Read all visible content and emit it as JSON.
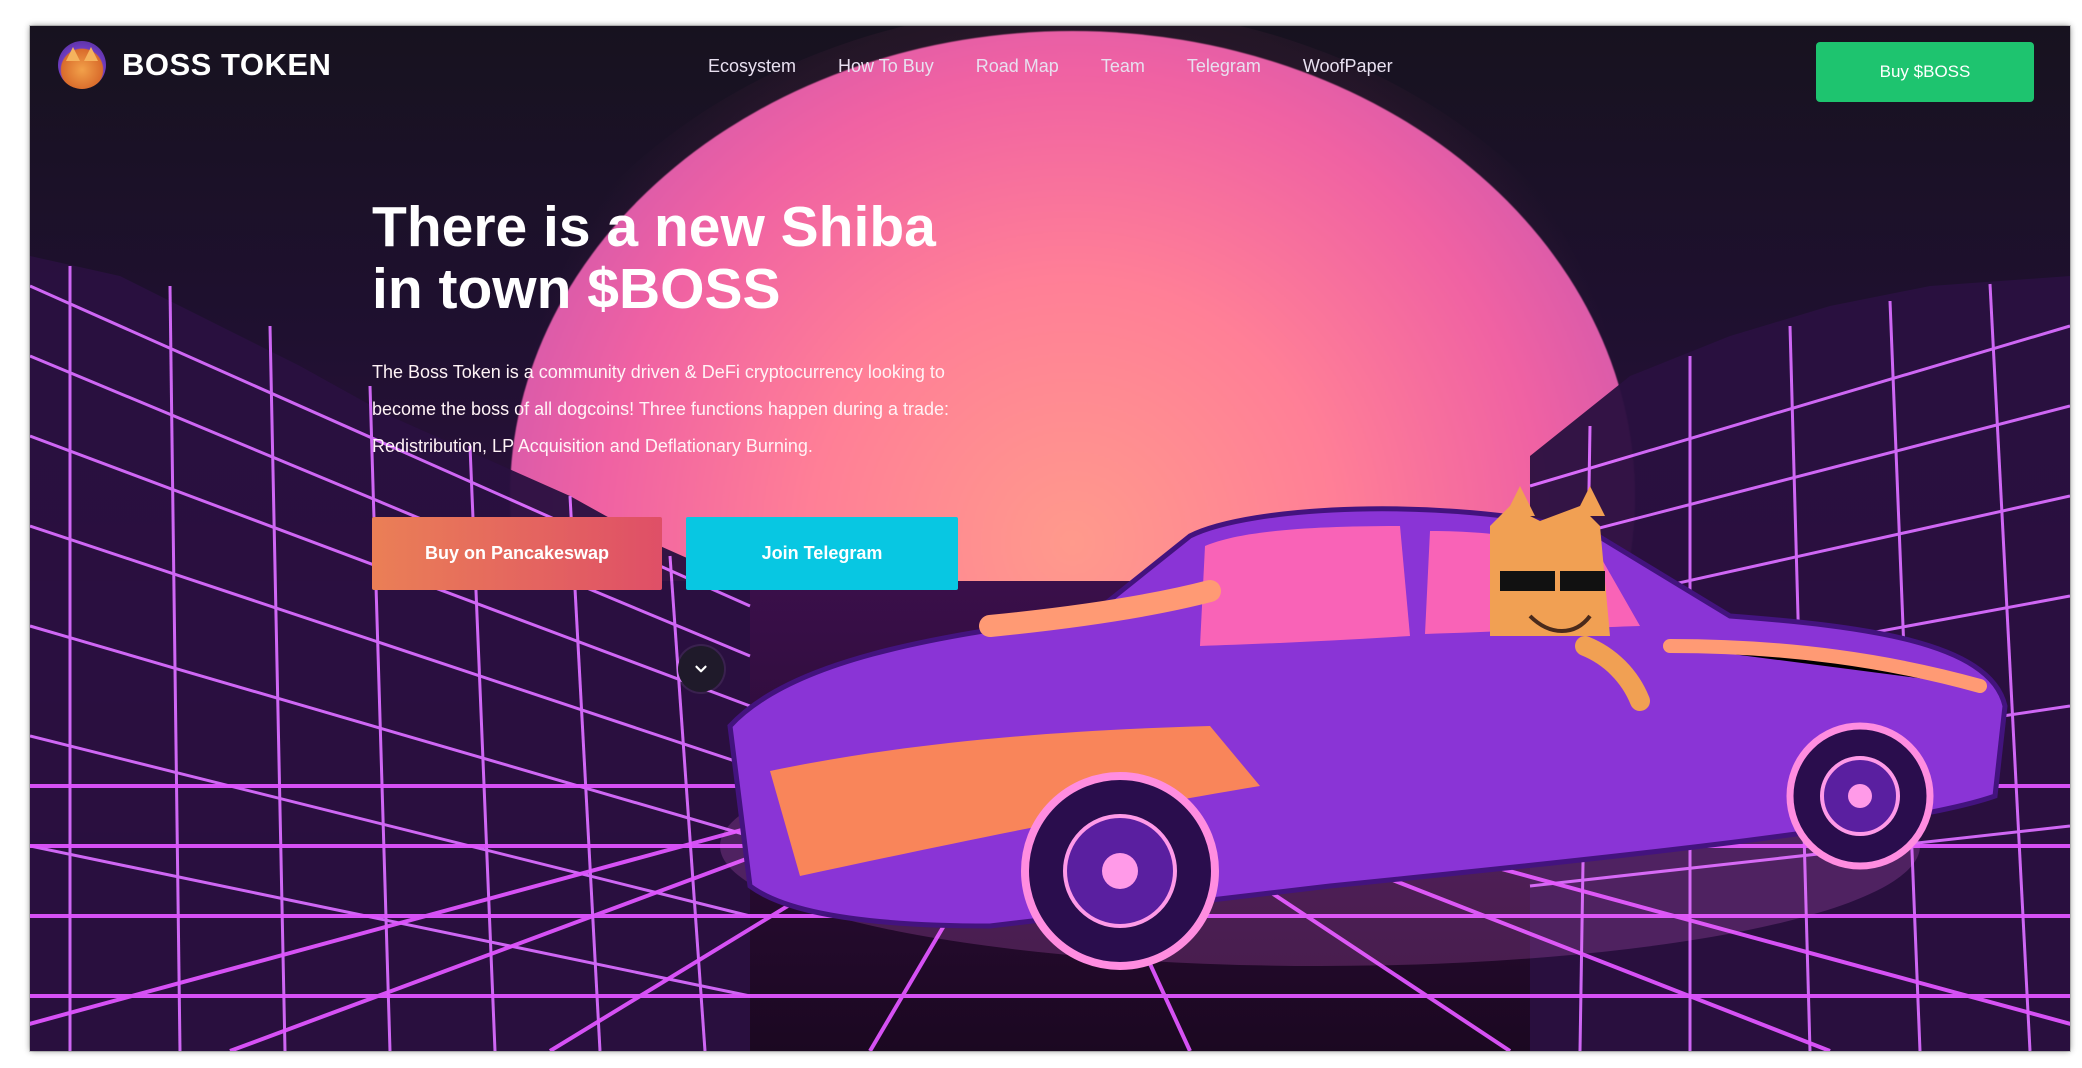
{
  "brand": {
    "name": "BOSS TOKEN",
    "logo_icon": "shiba-logo-icon"
  },
  "nav": {
    "links": [
      {
        "label": "Ecosystem"
      },
      {
        "label": "How To Buy"
      },
      {
        "label": "Road Map"
      },
      {
        "label": "Team"
      },
      {
        "label": "Telegram"
      },
      {
        "label": "WoofPaper"
      }
    ],
    "buy_button": "Buy $BOSS"
  },
  "hero": {
    "title_line1": "There is a new Shiba",
    "title_line2": "in town $BOSS",
    "description_line1": "The Boss Token is a community driven & DeFi cryptocurrency looking to",
    "description_line2": "become the boss of all dogcoins! Three functions happen during a trade:",
    "description_line3": "Redistribution, LP Acquisition and Deflationary Burning.",
    "btn_pancakeswap": "Buy on Pancakeswap",
    "btn_telegram": "Join Telegram",
    "scroll_icon": "chevron-down-icon"
  },
  "colors": {
    "buy_green": "#1ec46f",
    "pancake_start": "#ea7f56",
    "pancake_end": "#df4f67",
    "telegram_cyan": "#08c7e2",
    "sun_pink": "#ff7f97",
    "grid_magenta": "#e055ff"
  }
}
